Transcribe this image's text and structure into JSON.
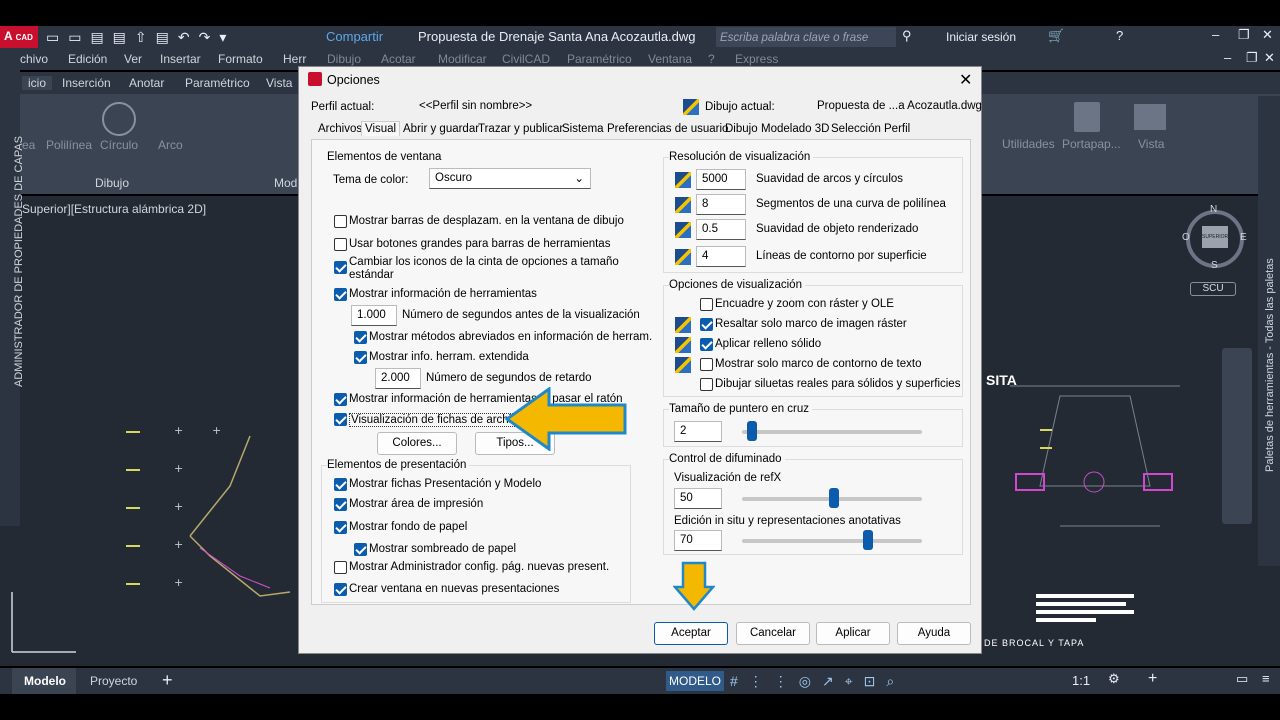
{
  "window": {
    "title": "Propuesta de Drenaje Santa Ana Acozautla.dwg",
    "share": "Compartir",
    "search_placeholder": "Escriba palabra clave o frase",
    "signin": "Iniciar sesión",
    "app_badge": "CAD"
  },
  "menu": [
    "chivo",
    "Edición",
    "Ver",
    "Insertar",
    "Formato",
    "Herr",
    "Dibujo",
    "Acotar",
    "Modificar",
    "CivilCAD",
    "Paramétrico",
    "Ventana",
    "?",
    "Express"
  ],
  "ribbon_tabs": [
    "icio",
    "Inserción",
    "Anotar",
    "Paramétrico",
    "Vista"
  ],
  "ribbon": {
    "tools": [
      "ea",
      "Polilínea",
      "Círculo",
      "Arco"
    ],
    "panel_label": "Dibujo",
    "mod_label": "Mod",
    "right_tools": [
      "Utilidades",
      "Portapap...",
      "Vista"
    ]
  },
  "canvas": {
    "viewport_label": "Superior][Estructura alámbrica 2D]",
    "side_palette": "ADMINISTRADOR DE PROPIEDADES DE CAPAS",
    "right_palette": "Paletas de herramientas - Todas las paletas",
    "compass": {
      "n": "N",
      "s": "S",
      "e": "E",
      "o": "O",
      "center": "SUPERIOR"
    },
    "ucs": "SCU",
    "drawing_text": "SITA",
    "section_title": "DE BROCAL Y TAPA"
  },
  "status": {
    "tabs": [
      "Modelo",
      "Proyecto"
    ],
    "mode": "MODELO",
    "scale": "1:1"
  },
  "dialog": {
    "title": "Opciones",
    "profile_label": "Perfil actual:",
    "profile_value": "<<Perfil sin nombre>>",
    "drawing_label": "Dibujo actual:",
    "drawing_value": "Propuesta de ...a Acozautla.dwg",
    "tabs": [
      "Archivos",
      "Visual",
      "Abrir y guardar",
      "Trazar y publicar",
      "Sistema",
      "Preferencias de usuario",
      "Dibujo",
      "Modelado 3D",
      "Selección",
      "Perfil"
    ],
    "window_elements": {
      "heading": "Elementos de ventana",
      "color_theme_label": "Tema de color:",
      "color_theme_value": "Oscuro",
      "checks": [
        {
          "label": "Mostrar barras de desplazam. en la ventana de dibujo",
          "on": false
        },
        {
          "label": "Usar botones grandes para barras de herramientas",
          "on": false
        },
        {
          "label": "Cambiar los iconos de la cinta de opciones a tamaño estándar",
          "on": true
        },
        {
          "label": "Mostrar información de herramientas",
          "on": true
        },
        {
          "label": "Mostrar métodos abreviados en información de herram.",
          "on": true
        },
        {
          "label": "Mostrar info. herram. extendida",
          "on": true
        },
        {
          "label": "Mostrar información de herramientas al pasar el ratón",
          "on": true
        },
        {
          "label": "Visualización de fichas de archivo",
          "on": true
        }
      ],
      "delay1_value": "1.000",
      "delay1_label": "Número de segundos antes de la visualización",
      "delay2_value": "2.000",
      "delay2_label": "Número de segundos de retardo",
      "colors_button": "Colores...",
      "fonts_button": "Tipos..."
    },
    "layout_elements": {
      "heading": "Elementos de presentación",
      "checks": [
        {
          "label": "Mostrar fichas Presentación y Modelo",
          "on": true
        },
        {
          "label": "Mostrar área de impresión",
          "on": true
        },
        {
          "label": "Mostrar fondo de papel",
          "on": true
        },
        {
          "label": "Mostrar sombreado de papel",
          "on": true
        },
        {
          "label": "Mostrar Administrador config. pág. nuevas present.",
          "on": false
        },
        {
          "label": "Crear ventana en nuevas presentaciones",
          "on": true
        }
      ]
    },
    "resolution": {
      "heading": "Resolución de visualización",
      "rows": [
        {
          "value": "5000",
          "label": "Suavidad de arcos y círculos"
        },
        {
          "value": "8",
          "label": "Segmentos de una curva de polilínea"
        },
        {
          "value": "0.5",
          "label": "Suavidad de objeto renderizado"
        },
        {
          "value": "4",
          "label": "Líneas de contorno por superficie"
        }
      ]
    },
    "display_options": {
      "heading": "Opciones de visualización",
      "checks": [
        {
          "label": "Encuadre y zoom con ráster y OLE",
          "on": false
        },
        {
          "label": "Resaltar solo marco de imagen ráster",
          "on": true
        },
        {
          "label": "Aplicar relleno sólido",
          "on": true
        },
        {
          "label": "Mostrar solo marco de contorno de texto",
          "on": false
        },
        {
          "label": "Dibujar siluetas reales para sólidos y superficies",
          "on": false
        }
      ]
    },
    "crosshair": {
      "heading": "Tamaño de puntero en cruz",
      "value": "2",
      "level": 0.02
    },
    "fade": {
      "heading": "Control de difuminado",
      "xref_label": "Visualización de refX",
      "xref_value": "50",
      "xref_level": 0.5,
      "inplace_label": "Edición in situ y representaciones anotativas",
      "inplace_value": "70",
      "inplace_level": 0.7
    },
    "buttons": {
      "ok": "Aceptar",
      "cancel": "Cancelar",
      "apply": "Aplicar",
      "help": "Ayuda"
    }
  },
  "colors": {
    "accent": "#0b5cad",
    "arrow": "#f5b800",
    "arrow_outline": "#1e88c8"
  }
}
